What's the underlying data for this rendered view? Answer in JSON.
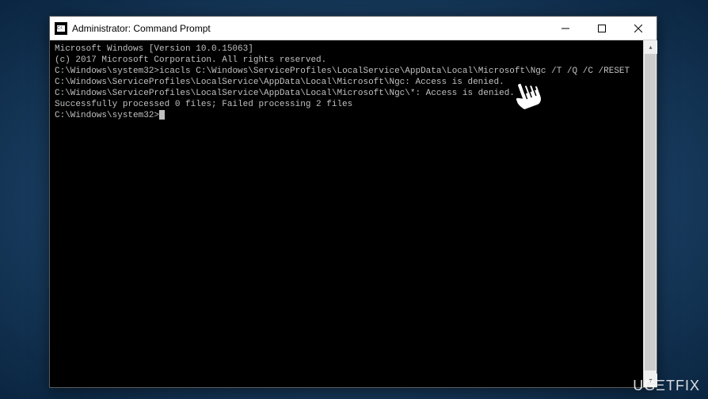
{
  "window": {
    "title": "Administrator: Command Prompt"
  },
  "controls": {
    "minimize": "—",
    "maximize": "☐",
    "close": "✕"
  },
  "console": {
    "header1": "Microsoft Windows [Version 10.0.15063]",
    "header2": "(c) 2017 Microsoft Corporation. All rights reserved.",
    "blank1": "",
    "prompt1_path": "C:\\Windows\\system32>",
    "prompt1_cmd": "icacls C:\\Windows\\ServiceProfiles\\LocalService\\AppData\\Local\\Microsoft\\Ngc /T /Q /C /RESET",
    "out1": "C:\\Windows\\ServiceProfiles\\LocalService\\AppData\\Local\\Microsoft\\Ngc: Access is denied.",
    "out2": "C:\\Windows\\ServiceProfiles\\LocalService\\AppData\\Local\\Microsoft\\Ngc\\*: Access is denied.",
    "out3": "Successfully processed 0 files; Failed processing 2 files",
    "blank2": "",
    "prompt2_path": "C:\\Windows\\system32>"
  },
  "watermark": "UGΞTFIX"
}
